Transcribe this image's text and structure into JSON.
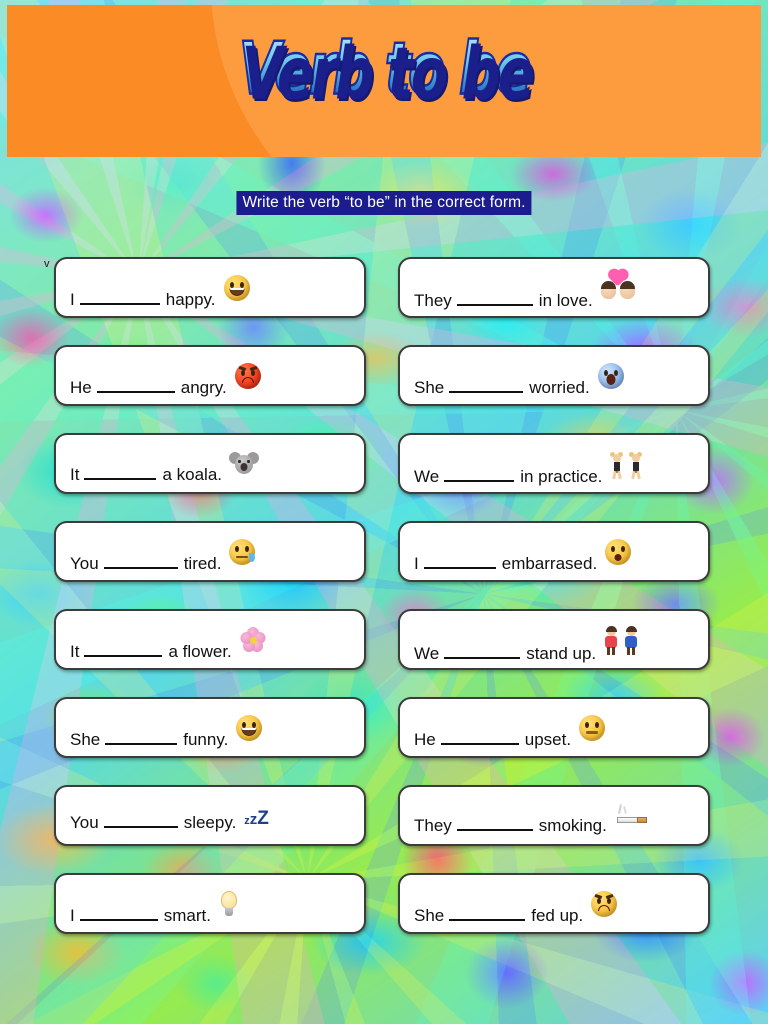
{
  "header": {
    "title": "Verb to be",
    "background_color": "#fb8b24",
    "title_color": "#2f7fc4"
  },
  "instruction": {
    "text": "Write the verb “to be” in the correct form.",
    "background_color": "#1c1c8f",
    "text_color": "#ffffff"
  },
  "stray_mark": "v",
  "exercises": {
    "left": [
      {
        "pronoun": "I",
        "rest": "happy.",
        "emoji": "grinning-face",
        "blank_width": 80
      },
      {
        "pronoun": "He",
        "rest": "angry.",
        "emoji": "angry-face-red",
        "blank_width": 78
      },
      {
        "pronoun": "It",
        "rest": "a koala.",
        "emoji": "koala-face",
        "blank_width": 72
      },
      {
        "pronoun": "You",
        "rest": "tired.",
        "emoji": "sleepy-face",
        "blank_width": 74
      },
      {
        "pronoun": "It",
        "rest": "a flower.",
        "emoji": "cherry-blossom",
        "blank_width": 78
      },
      {
        "pronoun": "She",
        "rest": "funny.",
        "emoji": "face-with-tears-of-joy",
        "blank_width": 72
      },
      {
        "pronoun": "You",
        "rest": "sleepy.",
        "emoji": "zzz",
        "blank_width": 74
      },
      {
        "pronoun": "I",
        "rest": "smart.",
        "emoji": "light-bulb",
        "blank_width": 78
      }
    ],
    "right": [
      {
        "pronoun": "They",
        "rest": "in love.",
        "emoji": "couple-with-heart",
        "blank_width": 76
      },
      {
        "pronoun": "She",
        "rest": "worried.",
        "emoji": "screaming-face",
        "blank_width": 74
      },
      {
        "pronoun": "We",
        "rest": "in practice.",
        "emoji": "women-with-bunny-ears",
        "blank_width": 70
      },
      {
        "pronoun": "I",
        "rest": "embarrased.",
        "emoji": "flushed-face",
        "blank_width": 72
      },
      {
        "pronoun": "We",
        "rest": "stand up.",
        "emoji": "man-and-woman-holding-hands",
        "blank_width": 76
      },
      {
        "pronoun": "He",
        "rest": "upset.",
        "emoji": "unamused-face",
        "blank_width": 78
      },
      {
        "pronoun": "They",
        "rest": "smoking.",
        "emoji": "cigarette",
        "blank_width": 76
      },
      {
        "pronoun": "She",
        "rest": "fed up.",
        "emoji": "pouting-face",
        "blank_width": 76
      }
    ]
  }
}
